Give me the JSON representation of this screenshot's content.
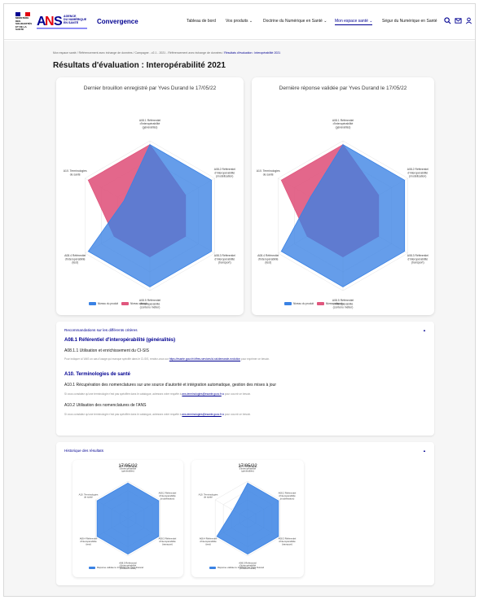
{
  "header": {
    "rf_lines": [
      "MINISTÈRE",
      "DES SOLIDARITÉS",
      "ET DE LA SANTÉ"
    ],
    "ans_lines": [
      "AGENCE",
      "DU NUMÉRIQUE",
      "EN SANTÉ"
    ],
    "brand": "Convergence",
    "nav": [
      {
        "label": "Tableau de bord",
        "active": false
      },
      {
        "label": "Vos produits ⌄",
        "active": false
      },
      {
        "label": "Doctrine du Numérique en Santé ⌄",
        "active": false
      },
      {
        "label": "Mon espace santé ⌄",
        "active": true
      },
      {
        "label": "Ségur du Numérique en Santé",
        "active": false
      }
    ],
    "icons": [
      "search-icon",
      "mail-icon",
      "user-icon"
    ]
  },
  "breadcrumb": {
    "parts": [
      "Mon espace santé",
      "/",
      "Référencement avec échange de données",
      "/",
      "Campagne - v2.1 - 2021 - Référencement avec échange de données",
      "/"
    ],
    "last": "Résultats d'évaluation : Interopérabilité 2021"
  },
  "page_title": "Résultats d'évaluation : Interopérabilité 2021",
  "colors": {
    "product": "#3a82e4",
    "required": "#e0577e",
    "accent": "#000091"
  },
  "charts": [
    {
      "title": "Dernier brouillon enregistré par Yves Durand le 17/05/22",
      "legend": [
        "Niveau du produit",
        "Niveau attendu"
      ]
    },
    {
      "title": "Dernière réponse validée par Yves Durand le 17/05/22",
      "legend": [
        "Niveau du produit",
        "Niveau attendu"
      ]
    }
  ],
  "chart_data": [
    {
      "type": "radar",
      "title": "Dernier brouillon enregistré par Yves Durand le 17/05/22",
      "axes": [
        "A08.1 Référentiel d'interopérabilité (généralités)",
        "A08.2 Référentiel d'interopérabilité (modélisation)",
        "A08.3 Référentiel d'interopérabilité (transport)",
        "A08.5 Référentiel d'interopérabilité (contenu métier)",
        "A08.4 Référentiel d'interopérabilité (test)",
        "A10. Terminologies de santé"
      ],
      "range": [
        0,
        1
      ],
      "grid": true,
      "legend_position": "bottom-left",
      "series": [
        {
          "name": "Niveau du produit",
          "values": [
            0.95,
            0.95,
            0.95,
            0.95,
            0.95,
            0.4
          ]
        },
        {
          "name": "Niveau attendu",
          "values": [
            0.95,
            0.55,
            0.55,
            0.55,
            0.55,
            0.95
          ]
        }
      ]
    },
    {
      "type": "radar",
      "title": "Dernière réponse validée par Yves Durand le 17/05/22",
      "axes": [
        "A08.1 Référentiel d'interopérabilité (généralités)",
        "A08.2 Référentiel d'interopérabilité (modélisation)",
        "A08.3 Référentiel d'interopérabilité (transport)",
        "A08.5 Référentiel d'interopérabilité (contenu métier)",
        "A08.4 Référentiel d'interopérabilité (test)",
        "A10. Terminologies de santé"
      ],
      "range": [
        0,
        1
      ],
      "grid": true,
      "legend_position": "bottom-left",
      "series": [
        {
          "name": "Niveau du produit",
          "values": [
            0.95,
            0.95,
            0.95,
            0.95,
            0.95,
            0.5
          ]
        },
        {
          "name": "Niveau attendu",
          "values": [
            0.95,
            0.55,
            0.55,
            0.55,
            0.55,
            0.95
          ]
        }
      ]
    },
    {
      "type": "radar",
      "title": "17/05/22",
      "axes": [
        "A08.1 Référentiel d'interopérabilité (généralités)",
        "A08.2 Référentiel d'interopérabilité (modélisation)",
        "A08.3 Référentiel d'interopérabilité (transport)",
        "A08.5 Référentiel d'interopérabilité (contenu métier)",
        "A08.4 Référentiel d'interopérabilité (test)",
        "A10. Terminologies de santé"
      ],
      "range": [
        0,
        1
      ],
      "grid": true,
      "legend_position": "bottom",
      "series": [
        {
          "name": "Réponse validée le 17/05/22 par Yves Durand",
          "values": [
            0.95,
            0.95,
            0.95,
            0.95,
            0.95,
            0.95
          ]
        }
      ]
    },
    {
      "type": "radar",
      "title": "17/05/22",
      "axes": [
        "A08.1 Référentiel d'interopérabilité (généralités)",
        "A08.2 Référentiel d'interopérabilité (modélisation)",
        "A08.3 Référentiel d'interopérabilité (transport)",
        "A08.5 Référentiel d'interopérabilité (contenu métier)",
        "A08.4 Référentiel d'interopérabilité (test)",
        "A10. Terminologies de santé"
      ],
      "range": [
        0,
        1
      ],
      "grid": true,
      "legend_position": "bottom",
      "series": [
        {
          "name": "Réponse validée le 17/05/22 par Yves Durand",
          "values": [
            0.95,
            0.95,
            0.95,
            0.95,
            0.95,
            0.45
          ]
        }
      ]
    }
  ],
  "axis_labels": {
    "top": [
      "A08.1 Référentiel",
      "d'interopérabilité",
      "(généralités)"
    ],
    "right_top": [
      "A08.2 Référentiel",
      "d'interopérabilité",
      "(modélisation)"
    ],
    "right_bottom": [
      "A08.3 Référentiel",
      "d'interopérabilité",
      "(transport)"
    ],
    "bottom": [
      "A08.5 Référentiel",
      "d'interopérabilité",
      "(contenu métier)"
    ],
    "left_bottom": [
      "A08.4 Référentiel",
      "d'interopérabilité",
      "(test)"
    ],
    "left_top": [
      "A10. Terminologies",
      "de santé"
    ]
  },
  "recommendations": {
    "heading": "Recommandations sur les différents critères",
    "caret": "▲",
    "s1_title": "A08.1 Référentiel d'interopérabilité (généralités)",
    "s1_sub": "A08.1.1 Utilisation et enrichissement du CI-SIS",
    "s1_text_pre": "Pour indiquer à l'ANS un cas d'usage qui manque spécifié dans le CI-SIS, rendez-vous sur",
    "s1_link": "https://esante.gouv.fr/offres-services/ci-sis/demande-evolution",
    "s1_text_post": "pour exprimer ce besoin.",
    "s2_title": "A10. Terminologies de santé",
    "s2_sub1": "A10.1 Récupération des nomenclatures sur une source d'autorité et intégration automatique, gestion des mises à jour",
    "s2_text1_pre": "Si vous constatez qu'une terminologie n'est pas spécifiée dans le catalogue, adressez votre requête à",
    "s2_link1": "ans-terminologies@esante.gouv.fr",
    "s2_text1_post": "pour couvrir ce besoin.",
    "s2_sub2": "A10.2 Utilisation des nomenclatures de l'ANS",
    "s2_text2_pre": "Si vous constatez qu'une terminologie n'est pas spécifiée dans le catalogue, adressez votre requête à",
    "s2_link2": "ans-terminologies@esante.gouv.fr",
    "s2_text2_post": "pour couvrir ce besoin.",
    "ext_icon": "⧉"
  },
  "history": {
    "heading": "Historique des résultats",
    "caret": "▲",
    "cards": [
      {
        "date": "17/05/22",
        "legend": "Réponse validée le 17/05/22 par Yves Durand"
      },
      {
        "date": "17/05/22",
        "legend": "Réponse validée le 17/05/22 par Yves Durand"
      }
    ]
  }
}
